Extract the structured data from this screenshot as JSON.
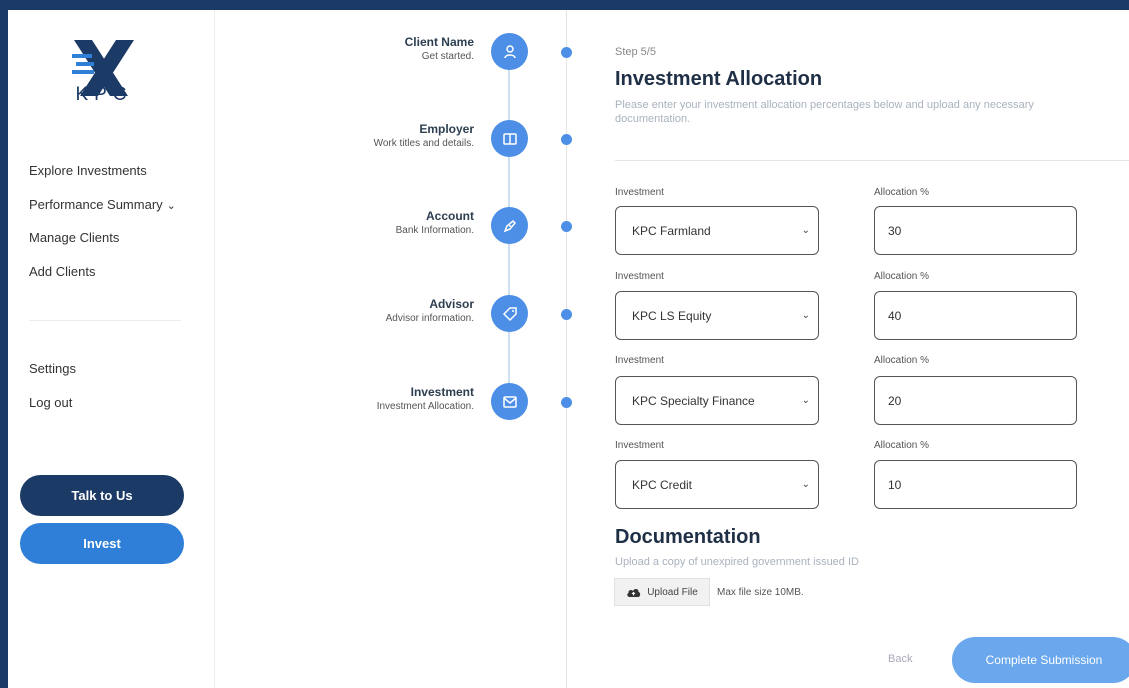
{
  "brand": {
    "name": "KPC",
    "colors": {
      "navy": "#1c3a66",
      "blue": "#2f7fd8",
      "step_blue": "#4d8fe6"
    }
  },
  "sidebar": {
    "nav": [
      {
        "label": "Explore Investments"
      },
      {
        "label": "Performance Summary",
        "chevron": "⌄"
      },
      {
        "label": "Manage Clients"
      },
      {
        "label": "Add Clients"
      }
    ],
    "secondary": [
      {
        "label": "Settings"
      },
      {
        "label": "Log out"
      }
    ],
    "talk_label": "Talk to Us",
    "invest_label": "Invest"
  },
  "steps": [
    {
      "title": "Client Name",
      "subtitle": "Get started.",
      "icon": "user-icon"
    },
    {
      "title": "Employer",
      "subtitle": "Work titles and details.",
      "icon": "book-icon"
    },
    {
      "title": "Account",
      "subtitle": "Bank Information.",
      "icon": "pen-icon"
    },
    {
      "title": "Advisor",
      "subtitle": "Advisor information.",
      "icon": "tag-icon"
    },
    {
      "title": "Investment",
      "subtitle": "Investment Allocation.",
      "icon": "mail-icon"
    }
  ],
  "form": {
    "step_count": "Step 5/5",
    "title": "Investment Allocation",
    "description": "Please enter your investment allocation percentages below and upload any necessary documentation.",
    "investment_label": "Investment",
    "allocation_label": "Allocation %",
    "rows": [
      {
        "investment": "KPC Farmland",
        "allocation": "30"
      },
      {
        "investment": "KPC LS Equity",
        "allocation": "40"
      },
      {
        "investment": "KPC Specialty Finance",
        "allocation": "20"
      },
      {
        "investment": "KPC Credit",
        "allocation": "10"
      }
    ]
  },
  "documentation": {
    "title": "Documentation",
    "description": "Upload a copy of unexpired government issued ID",
    "upload_label": "Upload File",
    "max_size": "Max file size 10MB."
  },
  "actions": {
    "back_label": "Back",
    "submit_label": "Complete Submission"
  }
}
